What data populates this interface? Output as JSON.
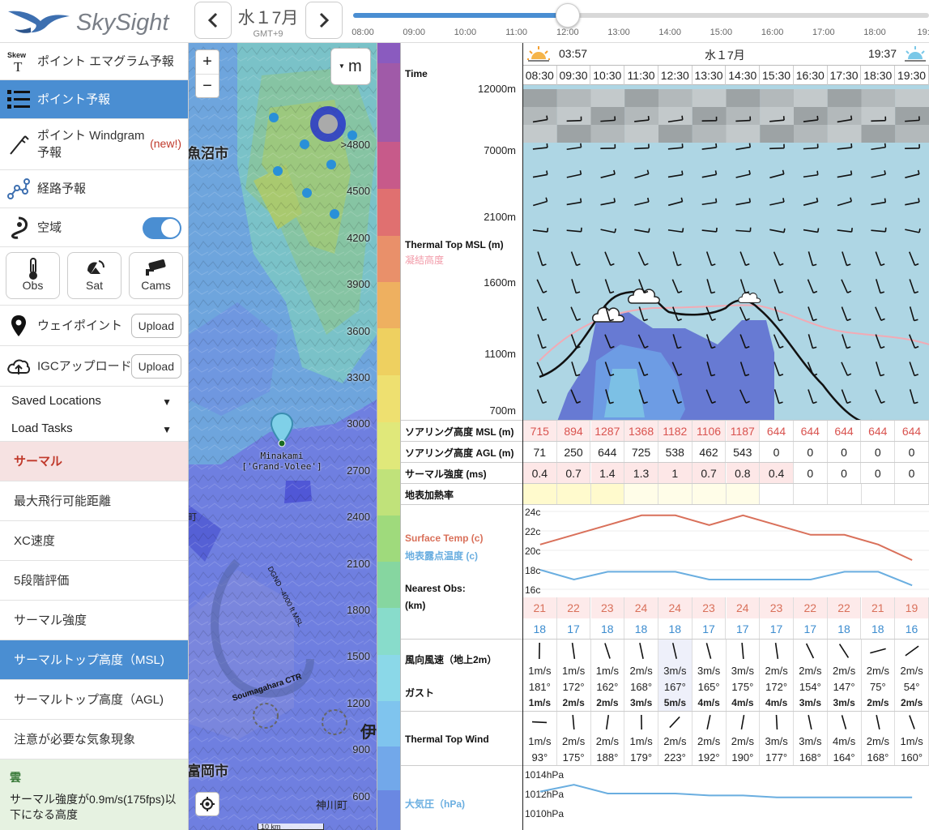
{
  "app": {
    "name": "SkySight"
  },
  "date": {
    "label": "水１7月",
    "timezone": "GMT+9"
  },
  "timeline": {
    "labels": [
      "08:00",
      "09:00",
      "10:00",
      "11:00",
      "12:00",
      "13:00",
      "14:00",
      "15:00",
      "16:00",
      "17:00",
      "18:00",
      "19:0"
    ],
    "selected": "12:00",
    "progress": 0.42
  },
  "sidebar": {
    "items": [
      {
        "label": "ポイント エマグラム予報",
        "icon": "skewt-icon"
      },
      {
        "label": "ポイント予報",
        "icon": "list-icon",
        "active": true
      },
      {
        "label": "ポイント Windgram 予報",
        "icon": "windgram-icon",
        "badge": "(new!)"
      },
      {
        "label": "経路予報",
        "icon": "route-icon"
      },
      {
        "label": "空域",
        "icon": "airspace-icon",
        "toggle": true
      }
    ],
    "tiles": [
      {
        "label": "Obs"
      },
      {
        "label": "Sat"
      },
      {
        "label": "Cams"
      }
    ],
    "skewt_icon_text": "Skew",
    "skewt_icon_letter": "T",
    "waypoint": {
      "label": "ウェイポイント",
      "button": "Upload"
    },
    "igc": {
      "label": "IGCアップロード",
      "button": "Upload"
    },
    "saved_locations": "Saved Locations",
    "load_tasks": "Load Tasks",
    "thermal_section": "サーマル",
    "layers": [
      "最大飛行可能距離",
      "XC速度",
      "5段階評価",
      "サーマル強度",
      "サーマルトップ高度（MSL)",
      "サーマルトップ高度（AGL)",
      "注意が必要な気象現象"
    ],
    "active_layer": "サーマルトップ高度（MSL)",
    "cloud_section": "雲",
    "cloud_note": "サーマル強度が0.9m/s(175fps)以下になる高度"
  },
  "map": {
    "zoom_in": "+",
    "zoom_out": "−",
    "units_button": "m",
    "places": [
      "魚沼市",
      "町",
      "富岡市",
      "神川町",
      "伊"
    ],
    "marker_name": "Minakami",
    "marker_sub": "['Grand-Volee']",
    "airspace_label": "Soumagahara CTR",
    "airspace_sub": "DGND ~4000 ft MSL",
    "scale": "10 km",
    "legend": [
      ">4800",
      "4500",
      "4200",
      "3900",
      "3600",
      "3300",
      "3000",
      "2700",
      "2400",
      "2100",
      "1800",
      "1500",
      "1200",
      "900",
      "600",
      "300"
    ]
  },
  "forecast": {
    "sunrise": "03:57",
    "sunset": "19:37",
    "date": "水１7月",
    "time_label": "Time",
    "times": [
      "08:30",
      "09:30",
      "10:30",
      "11:30",
      "12:30",
      "13:30",
      "14:30",
      "15:30",
      "16:30",
      "17:30",
      "18:30",
      "19:30"
    ],
    "altitudes": [
      "12000m",
      "7000m",
      "2100m",
      "1600m",
      "1100m",
      "700m"
    ],
    "thermal_top_label": "Thermal Top MSL (m)",
    "condensation_label": "凝結高度",
    "rows": {
      "soaring_msl": {
        "label": "ソアリング高度 MSL (m)",
        "values": [
          "715",
          "894",
          "1287",
          "1368",
          "1182",
          "1106",
          "1187",
          "644",
          "644",
          "644",
          "644",
          "644"
        ]
      },
      "soaring_agl": {
        "label": "ソアリング高度 AGL (m)",
        "values": [
          "71",
          "250",
          "644",
          "725",
          "538",
          "462",
          "543",
          "0",
          "0",
          "0",
          "0",
          "0"
        ]
      },
      "thermal_strength": {
        "label": "サーマル強度 (ms)",
        "values": [
          "0.4",
          "0.7",
          "1.4",
          "1.3",
          "1",
          "0.7",
          "0.8",
          "0.4",
          "0",
          "0",
          "0",
          "0"
        ]
      },
      "surface_heating": {
        "label": "地表加熱率"
      }
    },
    "surface_temp_label": "Surface Temp (c)",
    "dewpoint_label": "地表露点温度 (c)",
    "temp_axis": [
      "24c",
      "22c",
      "20c",
      "18c",
      "16c"
    ],
    "surface_temp": [
      21,
      22,
      23,
      24,
      24,
      23,
      24,
      23,
      22,
      22,
      21,
      19
    ],
    "dewpoint": [
      18,
      17,
      18,
      18,
      18,
      17,
      17,
      17,
      17,
      18,
      18,
      16
    ],
    "nearest_obs_label": "Nearest Obs:",
    "nearest_obs_unit": "(km)",
    "obs_temp": [
      "21",
      "22",
      "23",
      "24",
      "24",
      "23",
      "24",
      "23",
      "22",
      "22",
      "21",
      "19"
    ],
    "obs_dew": [
      "18",
      "17",
      "18",
      "18",
      "18",
      "17",
      "17",
      "17",
      "17",
      "18",
      "18",
      "16"
    ],
    "wind_label": "風向風速（地上2m）",
    "gust_label": "ガスト",
    "wind_speed": [
      "1m/s",
      "1m/s",
      "1m/s",
      "2m/s",
      "3m/s",
      "3m/s",
      "3m/s",
      "2m/s",
      "2m/s",
      "2m/s",
      "2m/s",
      "2m/s"
    ],
    "wind_dir": [
      "181°",
      "172°",
      "162°",
      "168°",
      "167°",
      "165°",
      "175°",
      "172°",
      "154°",
      "147°",
      "75°",
      "54°"
    ],
    "gust": [
      "1m/s",
      "2m/s",
      "2m/s",
      "3m/s",
      "5m/s",
      "4m/s",
      "4m/s",
      "4m/s",
      "3m/s",
      "3m/s",
      "2m/s",
      "2m/s"
    ],
    "ttw_label": "Thermal Top Wind",
    "ttw_speed": [
      "1m/s",
      "2m/s",
      "2m/s",
      "1m/s",
      "2m/s",
      "2m/s",
      "2m/s",
      "3m/s",
      "3m/s",
      "4m/s",
      "2m/s",
      "1m/s"
    ],
    "ttw_dir": [
      "93°",
      "175°",
      "188°",
      "179°",
      "223°",
      "192°",
      "190°",
      "177°",
      "168°",
      "164°",
      "168°",
      "160°"
    ],
    "pressure_label": "大気圧（hPa)",
    "pressure_axis": [
      "1014hPa",
      "1012hPa",
      "1010hPa"
    ],
    "pressure": [
      1012.2,
      1012.9,
      1012.0,
      1012.0,
      1012.0,
      1011.8,
      1011.8,
      1011.6,
      1011.6,
      1011.6,
      1011.6,
      1011.6
    ]
  },
  "colors": {
    "accent": "#4a8ed2",
    "surface_temp": "#d9705a",
    "dewpoint": "#6aaee0",
    "soaring": "#d9534f",
    "section": "#c0392b"
  }
}
